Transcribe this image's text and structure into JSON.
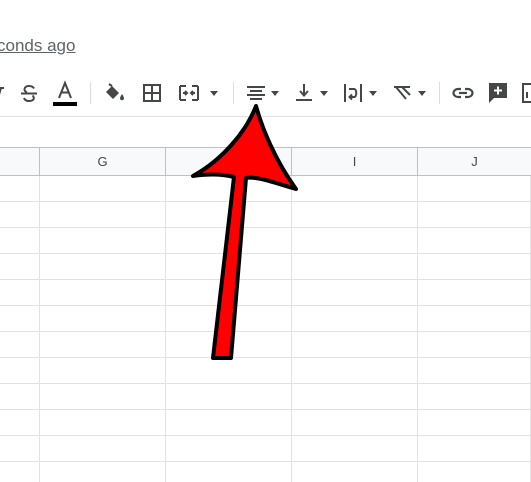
{
  "header": {
    "saved_status": "conds ago"
  },
  "toolbar": {
    "buttons": [
      {
        "name": "strikethrough",
        "icon": "strikethrough-icon"
      },
      {
        "name": "text-color",
        "icon": "text-color-icon"
      },
      {
        "name": "fill-color",
        "icon": "fill-color-icon"
      },
      {
        "name": "borders",
        "icon": "borders-icon"
      },
      {
        "name": "merge-cells",
        "icon": "merge-cells-icon"
      },
      {
        "name": "horizontal-align",
        "icon": "horizontal-align-icon"
      },
      {
        "name": "vertical-align",
        "icon": "vertical-align-icon"
      },
      {
        "name": "text-wrapping",
        "icon": "text-wrapping-icon"
      },
      {
        "name": "text-rotation",
        "icon": "text-rotation-icon"
      },
      {
        "name": "insert-link",
        "icon": "link-icon"
      },
      {
        "name": "insert-comment",
        "icon": "comment-add-icon"
      },
      {
        "name": "insert-chart",
        "icon": "chart-icon"
      }
    ]
  },
  "sheet": {
    "columns": [
      "",
      "G",
      "",
      "I",
      "J"
    ]
  },
  "colors": {
    "icon": "#444746",
    "text_color_bar": "#000000",
    "header_bg": "#f8f9fa",
    "grid_line": "#e2e2e2",
    "arrow_fill": "#ff0000",
    "arrow_stroke": "#000000"
  }
}
